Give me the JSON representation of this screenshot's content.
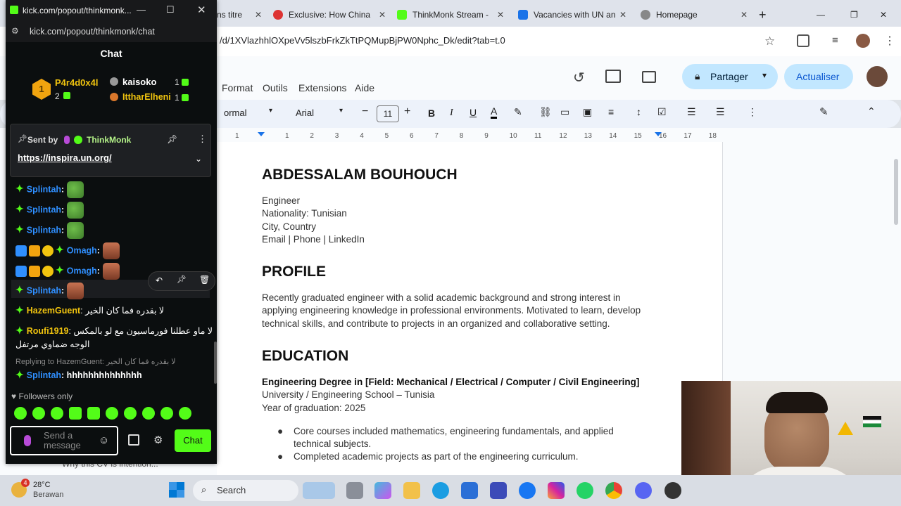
{
  "browser": {
    "tabs": [
      {
        "title": "ns titre"
      },
      {
        "title": "Exclusive: How China"
      },
      {
        "title": "ThinkMonk Stream -"
      },
      {
        "title": "Vacancies with UN an"
      },
      {
        "title": "Homepage"
      }
    ],
    "url": "/d/1XVlazhhlOXpeVv5lszbFrkZkTtPQMupBjPW0Nphc_Dk/edit?tab=t.0"
  },
  "docs": {
    "menu": [
      "Format",
      "Outils",
      "Extensions",
      "Aide"
    ],
    "share_label": "Partager",
    "update_label": "Actualiser",
    "style_value": "ormal",
    "font_value": "Arial",
    "font_size": "11",
    "ruler_ticks": [
      "1",
      "1",
      "2",
      "3",
      "4",
      "5",
      "6",
      "7",
      "8",
      "9",
      "10",
      "11",
      "12",
      "13",
      "14",
      "15",
      "16",
      "17",
      "18"
    ],
    "name": "ABDESSALAM BOUHOUCH",
    "contact": [
      "Engineer",
      "Nationality: Tunisian",
      "City, Country",
      "Email | Phone | LinkedIn"
    ],
    "profile_heading": "PROFILE",
    "profile_text": [
      "Recently graduated engineer with a solid academic background and strong interest in",
      "applying engineering knowledge in professional environments. Motivated to learn, develop",
      "technical skills, and contribute to projects in an organized and collaborative setting."
    ],
    "education_heading": "EDUCATION",
    "degree": "Engineering Degree in [Field: Mechanical / Electrical / Computer / Civil Engineering]",
    "school": "University / Engineering School – Tunisia",
    "grad_year": "Year of graduation: 2025",
    "bullets": [
      "Core courses included mathematics, engineering fundamentals, and applied",
      "technical subjects.",
      "Completed academic projects as part of the engineering curriculum."
    ]
  },
  "kick": {
    "window_title": "kick.com/popout/thinkmonk...",
    "url": "kick.com/popout/thinkmonk/chat",
    "panel_title": "Chat",
    "leaderboard": [
      {
        "rank": "1",
        "name": "P4r4d0x4l",
        "count": "2"
      },
      {
        "name": "kaisoko",
        "count": "1"
      },
      {
        "name": "IttharElheni",
        "count": "1"
      }
    ],
    "pinned": {
      "sent_by_label": "Sent by",
      "sender": "ThinkMonk",
      "link": "https://inspira.un.org/"
    },
    "messages": [
      {
        "user": "Splintah",
        "text": ":"
      },
      {
        "user": "Splintah",
        "text": ":"
      },
      {
        "user": "Splintah",
        "text": ":"
      },
      {
        "user": "Omagh",
        "text": ":"
      },
      {
        "user": "Omagh",
        "text": ":"
      },
      {
        "user": "Splintah",
        "text": ":"
      },
      {
        "user": "HazemGuent",
        "text": ": لا بقدره فما كان الخير"
      },
      {
        "user": "Roufi1919",
        "text": ": لا ماو عطلنا فورماسيون مع لو بالمكس"
      },
      {
        "user": "",
        "text": "الوجه ضماوي مرتفل"
      }
    ],
    "reply": {
      "label": "Replying to HazemGuent: لا بقدره فما كان الخير",
      "user": "Splintah",
      "text": ": hhhhhhhhhhhhhh"
    },
    "followers_only": "Followers only",
    "input_placeholder": "Send a message",
    "send_label": "Chat"
  },
  "taskbar": {
    "temp": "28°C",
    "weather": "Berawan",
    "search_label": "Search",
    "notification_count": "4"
  },
  "behind_text": "Why this CV is intention..."
}
